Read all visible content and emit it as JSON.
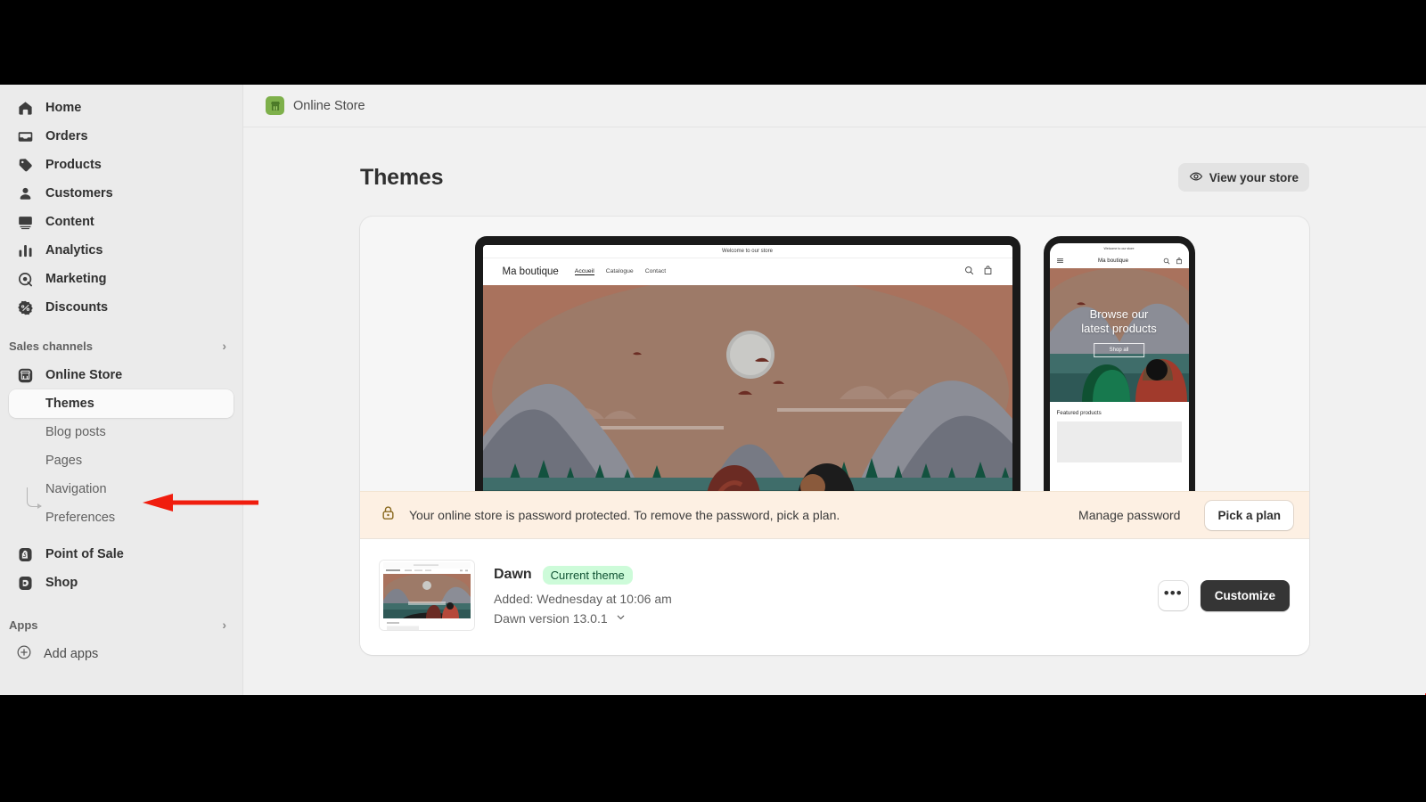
{
  "topbar": {
    "store_label": "Online Store",
    "icon": "storefront-icon"
  },
  "sidebar": {
    "items": [
      {
        "label": "Home",
        "icon": "home-icon"
      },
      {
        "label": "Orders",
        "icon": "orders-inbox-icon"
      },
      {
        "label": "Products",
        "icon": "tag-icon"
      },
      {
        "label": "Customers",
        "icon": "person-icon"
      },
      {
        "label": "Content",
        "icon": "content-image-icon"
      },
      {
        "label": "Analytics",
        "icon": "bar-chart-icon"
      },
      {
        "label": "Marketing",
        "icon": "target-icon"
      },
      {
        "label": "Discounts",
        "icon": "discount-badge-icon"
      }
    ],
    "sales_channels": {
      "label": "Sales channels",
      "chevron": "chevron-right-icon"
    },
    "online_store": {
      "label": "Online Store",
      "icon": "storefront-icon"
    },
    "sub_items": [
      {
        "label": "Themes",
        "active": true
      },
      {
        "label": "Blog posts",
        "active": false
      },
      {
        "label": "Pages",
        "active": false
      },
      {
        "label": "Navigation",
        "active": false
      },
      {
        "label": "Preferences",
        "active": false
      }
    ],
    "channels": [
      {
        "label": "Point of Sale",
        "icon": "shopify-bag-icon"
      },
      {
        "label": "Shop",
        "icon": "shop-icon"
      }
    ],
    "apps": {
      "label": "Apps",
      "chevron": "chevron-right-icon"
    },
    "add_apps": {
      "label": "Add apps",
      "icon": "plus-circle-icon"
    }
  },
  "page": {
    "title": "Themes",
    "view_store_button": {
      "label": "View your store",
      "icon": "eye-icon"
    }
  },
  "preview": {
    "desktop": {
      "announcement": "Welcome to our store",
      "logo": "Ma boutique",
      "nav": [
        "Accueil",
        "Catalogue",
        "Contact"
      ],
      "selected_nav": "Accueil",
      "icons": [
        "search-icon",
        "cart-icon"
      ]
    },
    "mobile": {
      "announcement": "Welcome to our store",
      "logo": "Ma boutique",
      "menu_icon": "hamburger-icon",
      "icons": [
        "search-icon",
        "cart-icon"
      ],
      "hero_heading_line1": "Browse our",
      "hero_heading_line2": "latest products",
      "hero_button": "Shop all",
      "section_title": "Featured products"
    }
  },
  "banner": {
    "icon": "lock-icon",
    "message": "Your online store is password protected. To remove the password, pick a plan.",
    "manage_link": "Manage password",
    "pick_plan_button": "Pick a plan",
    "background": "#fdf0e3"
  },
  "theme": {
    "name": "Dawn",
    "badge": "Current theme",
    "badge_bg": "#cdfbd9",
    "added": "Added: Wednesday at 10:06 am",
    "version": "Dawn version 13.0.1",
    "version_chevron": "chevron-down-icon",
    "more_button": "•••",
    "customize_button": "Customize"
  },
  "annotations": {
    "color": "#f01d0e",
    "arrows": [
      {
        "name": "arrow-pointing-to-themes",
        "direction": "left",
        "target": "Themes"
      },
      {
        "name": "arrow-pointing-to-more-actions",
        "direction": "right",
        "target": "more-actions-button"
      }
    ]
  }
}
